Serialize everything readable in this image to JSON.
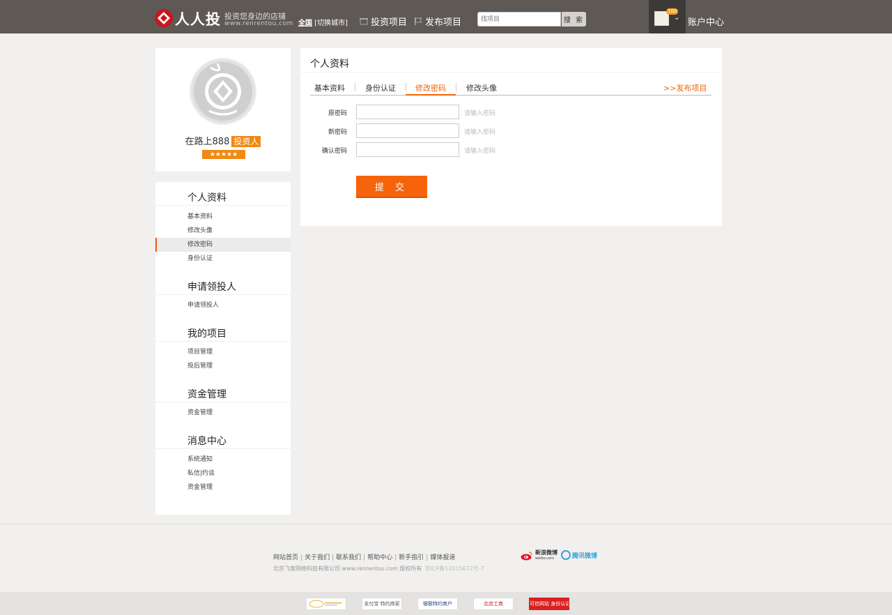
{
  "header": {
    "logo_name": "人人投",
    "slogan": "投资您身边的店铺",
    "site_url": "www.renrentou.com",
    "city_all": "全国",
    "city_switch": "[切换城市]",
    "nav_invest": "投资项目",
    "nav_publish": "发布项目",
    "search_placeholder": "找项目",
    "search_button": "搜 索",
    "badge_count": "100",
    "account_center": "账户中心"
  },
  "profile": {
    "username": "在路上888",
    "role": "投资人",
    "stars": "★★★★★"
  },
  "sidebar": {
    "sections": [
      {
        "title": "个人资料",
        "items": [
          "基本资料",
          "修改头像",
          "修改密码",
          "身份认证"
        ]
      },
      {
        "title": "申请领投人",
        "items": [
          "申请领投人"
        ]
      },
      {
        "title": "我的项目",
        "items": [
          "项目管理",
          "投后管理"
        ]
      },
      {
        "title": "资金管理",
        "items": [
          "资金管理"
        ]
      },
      {
        "title": "消息中心",
        "items": [
          "系统通知",
          "私信|约谈",
          "资金管理"
        ]
      }
    ],
    "active_item": "修改密码"
  },
  "main": {
    "title": "个人资料",
    "tabs": [
      "基本资料",
      "身份认证",
      "修改密码",
      "修改头像"
    ],
    "active_tab": "修改密码",
    "publish_link": ">>发布项目",
    "fields": [
      {
        "label": "原密码",
        "value": "",
        "hint": "请输入密码"
      },
      {
        "label": "新密码",
        "value": "",
        "hint": "请输入密码"
      },
      {
        "label": "确认密码",
        "value": "",
        "hint": "请输入密码"
      }
    ],
    "submit_label": "提 交"
  },
  "footer": {
    "links": [
      "网站首页",
      "关于我们",
      "联系我们",
      "帮助中心",
      "新手指引",
      "媒体报道"
    ],
    "company": "北京飞度网络科技有限公司 www.renrentou.com 版权所有",
    "icp": "京ICP备12015672号-7",
    "sina_weibo": "新浪微博",
    "sina_weibo_sub": "weibo.com",
    "tencent_weibo": "腾讯微博",
    "certs": [
      "",
      "支付宝 特约商家",
      "银联特约商户",
      "北京工商",
      "可信网站 身份认证"
    ]
  },
  "colors": {
    "accent": "#f5640a",
    "topbar": "#5e5955",
    "role_badge": "#f08a14"
  }
}
